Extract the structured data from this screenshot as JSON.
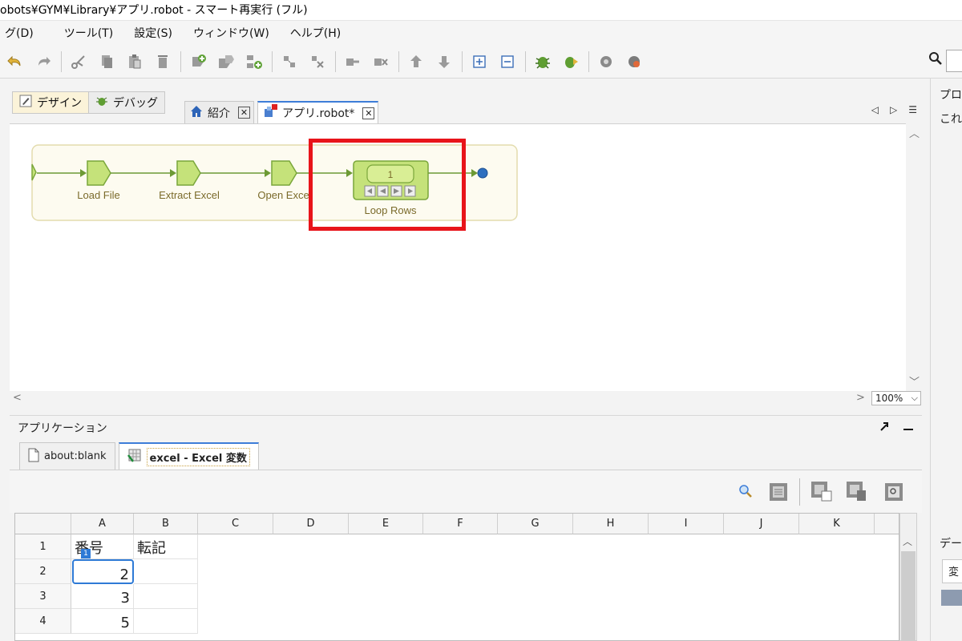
{
  "window": {
    "title": "obots¥GYM¥Library¥アプリ.robot - スマート再実行 (フル)"
  },
  "menu": {
    "items": [
      {
        "label": "グ(D)",
        "key": "debug"
      },
      {
        "label": "ツール(T)",
        "key": "tools"
      },
      {
        "label": "設定(S)",
        "key": "settings"
      },
      {
        "label": "ウィンドウ(W)",
        "key": "window"
      },
      {
        "label": "ヘルプ(H)",
        "key": "help"
      }
    ]
  },
  "modes": {
    "design": "デザイン",
    "debug": "デバッグ"
  },
  "editor_tabs": [
    {
      "label": "紹介",
      "icon": "home-icon"
    },
    {
      "label": "アプリ.robot*",
      "icon": "robot-icon"
    }
  ],
  "flow": {
    "steps": [
      {
        "label": "Load File"
      },
      {
        "label": "Extract Excel"
      },
      {
        "label": "Open Excel"
      }
    ],
    "loop": {
      "label": "Loop Rows",
      "counter": "1"
    }
  },
  "zoom": {
    "value": "100%"
  },
  "application_panel": {
    "title": "アプリケーション",
    "tabs": [
      {
        "label": "about:blank",
        "icon": "page-icon"
      },
      {
        "label": "excel - Excel 変数",
        "icon": "excel-icon"
      }
    ]
  },
  "sheet": {
    "columns": [
      "A",
      "B",
      "C",
      "D",
      "E",
      "F",
      "G",
      "H",
      "I",
      "J",
      "K"
    ],
    "rows": [
      {
        "num": "1",
        "A": "番号",
        "B": "転記"
      },
      {
        "num": "2",
        "A": "2",
        "B": ""
      },
      {
        "num": "3",
        "A": "3",
        "B": ""
      },
      {
        "num": "4",
        "A": "5",
        "B": ""
      }
    ],
    "row_marker": "1"
  },
  "right_panel": {
    "top_label": "プロ",
    "second_label": "これ",
    "bottom_label": "デー",
    "field_label": "変"
  },
  "colors": {
    "step_fill": "#c5e27a",
    "step_stroke": "#7aa63a",
    "flow_bg": "#fdfbf0",
    "flow_border": "#e3dcae",
    "highlight": "#e8141a",
    "accent": "#2e7ad6"
  }
}
